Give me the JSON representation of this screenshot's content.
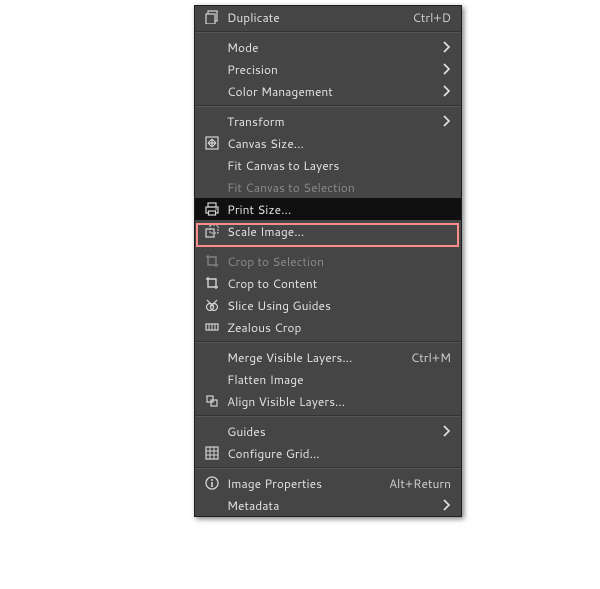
{
  "menu": {
    "sections": [
      [
        {
          "id": "duplicate",
          "label": "Duplicate",
          "shortcut": "Ctrl+D",
          "icon": "duplicate-icon"
        }
      ],
      [
        {
          "id": "mode",
          "label": "Mode",
          "submenu": true
        },
        {
          "id": "precision",
          "label": "Precision",
          "submenu": true
        },
        {
          "id": "color-management",
          "label": "Color Management",
          "submenu": true
        }
      ],
      [
        {
          "id": "transform",
          "label": "Transform",
          "submenu": true
        },
        {
          "id": "canvas-size",
          "label": "Canvas Size...",
          "icon": "canvas-size-icon"
        },
        {
          "id": "fit-canvas-layers",
          "label": "Fit Canvas to Layers"
        },
        {
          "id": "fit-canvas-selection",
          "label": "Fit Canvas to Selection",
          "disabled": true
        },
        {
          "id": "print-size",
          "label": "Print Size...",
          "icon": "printer-icon",
          "hovered": true
        },
        {
          "id": "scale-image",
          "label": "Scale Image...",
          "icon": "scale-icon"
        }
      ],
      [
        {
          "id": "crop-selection",
          "label": "Crop to Selection",
          "icon": "crop-icon",
          "disabled": true
        },
        {
          "id": "crop-content",
          "label": "Crop to Content",
          "icon": "crop-icon"
        },
        {
          "id": "slice-guides",
          "label": "Slice Using Guides",
          "icon": "slice-icon"
        },
        {
          "id": "zealous-crop",
          "label": "Zealous Crop",
          "icon": "zealous-icon"
        }
      ],
      [
        {
          "id": "merge-visible",
          "label": "Merge Visible Layers...",
          "shortcut": "Ctrl+M"
        },
        {
          "id": "flatten-image",
          "label": "Flatten Image"
        },
        {
          "id": "align-visible",
          "label": "Align Visible Layers...",
          "icon": "align-icon"
        }
      ],
      [
        {
          "id": "guides",
          "label": "Guides",
          "submenu": true
        },
        {
          "id": "configure-grid",
          "label": "Configure Grid...",
          "icon": "grid-icon"
        }
      ],
      [
        {
          "id": "image-properties",
          "label": "Image Properties",
          "shortcut": "Alt+Return",
          "icon": "info-icon"
        },
        {
          "id": "metadata",
          "label": "Metadata",
          "submenu": true
        }
      ]
    ]
  }
}
